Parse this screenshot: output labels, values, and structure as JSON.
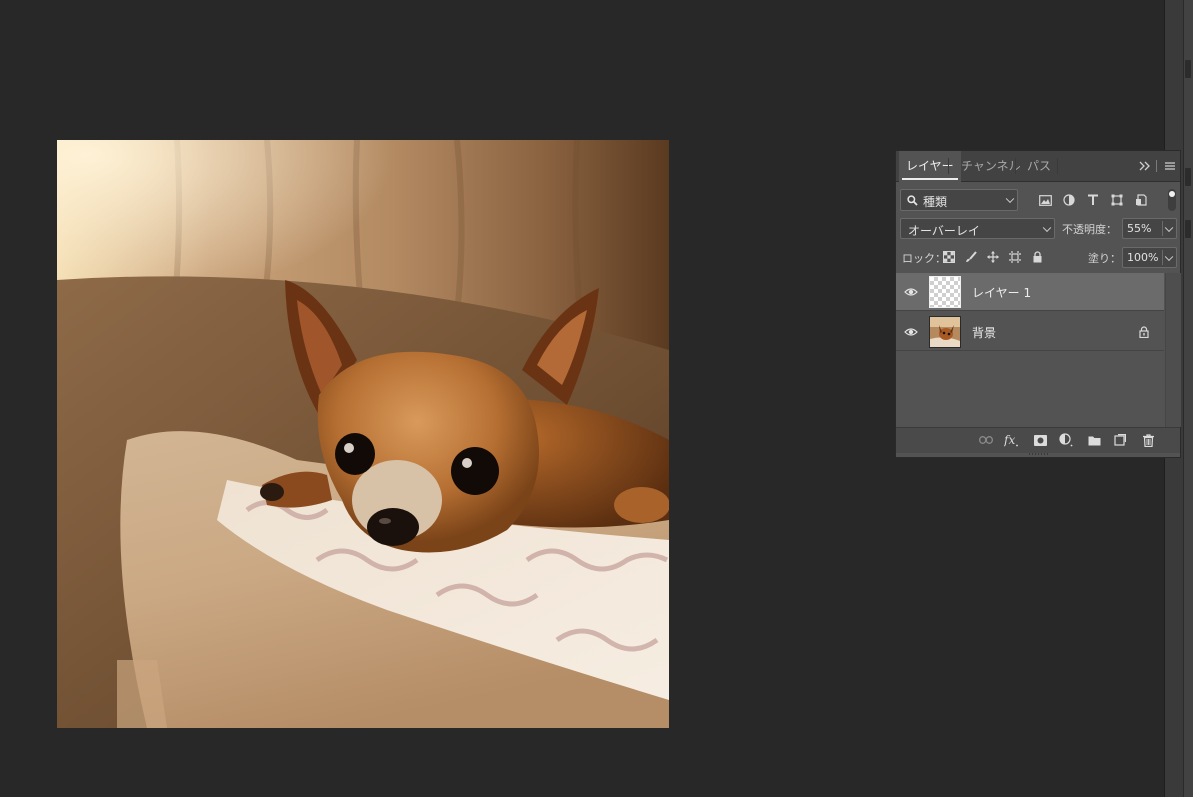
{
  "panel": {
    "tabs": [
      {
        "label": "レイヤー",
        "active": true
      },
      {
        "label": "チャンネル",
        "active": false
      },
      {
        "label": "パス",
        "active": false
      }
    ],
    "filter": {
      "value": "種類"
    },
    "blend_mode": {
      "value": "オーバーレイ"
    },
    "opacity": {
      "label": "不透明度：",
      "value": "55%"
    },
    "lock": {
      "label": "ロック："
    },
    "fill": {
      "label": "塗り：",
      "value": "100%"
    },
    "layers": [
      {
        "name": "レイヤー 1",
        "selected": true,
        "thumbnail": "transparent-checkerboard",
        "visible": true
      },
      {
        "name": "背景",
        "selected": false,
        "thumbnail": "chihuahua-photo",
        "visible": true,
        "locked": true
      }
    ],
    "filter_icons": [
      "image-filter-icon",
      "adjustment-filter-icon",
      "type-filter-icon",
      "shape-filter-icon",
      "smart-object-filter-icon"
    ],
    "lock_icons": [
      "lock-transparent-pixels-icon",
      "lock-image-pixels-icon",
      "lock-position-icon",
      "lock-artboard-icon",
      "lock-all-icon"
    ],
    "footer_icons": [
      "link-layers-icon",
      "fx-icon",
      "add-mask-icon",
      "new-adjustment-layer-icon",
      "new-group-icon",
      "new-layer-icon",
      "delete-layer-icon"
    ]
  },
  "colors": {
    "workspace_bg": "#282828",
    "panel_bg": "#535353",
    "selected_layer": "#6b6b6b"
  }
}
